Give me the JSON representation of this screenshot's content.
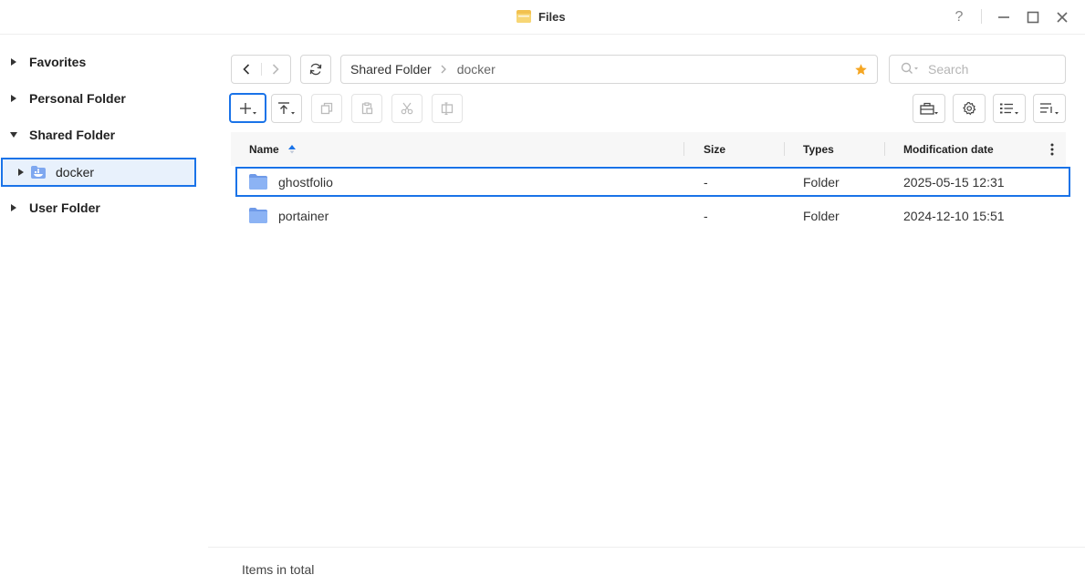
{
  "window": {
    "title": "Files",
    "controls": [
      "help-icon",
      "minimize-icon",
      "maximize-icon",
      "close-icon"
    ],
    "help_label": "?"
  },
  "sidebar": {
    "items": [
      {
        "label": "Favorites",
        "expanded": false
      },
      {
        "label": "Personal Folder",
        "expanded": false
      },
      {
        "label": "Shared Folder",
        "expanded": true,
        "children": [
          {
            "label": "docker",
            "icon": "shared-folder-icon",
            "selected": true
          }
        ]
      },
      {
        "label": "User Folder",
        "expanded": false
      }
    ]
  },
  "navigation": {
    "breadcrumb": [
      "Shared Folder",
      "docker"
    ],
    "favorite": true,
    "search": {
      "placeholder": "Search",
      "value": ""
    }
  },
  "toolbar": {
    "left_buttons": [
      {
        "icon": "plus-icon",
        "menu": true,
        "enabled": true
      },
      {
        "icon": "upload-icon",
        "menu": true,
        "enabled": true
      },
      {
        "icon": "copy-icon",
        "enabled": false
      },
      {
        "icon": "paste-icon",
        "enabled": false
      },
      {
        "icon": "cut-icon",
        "enabled": false
      },
      {
        "icon": "rename-icon",
        "enabled": false
      }
    ],
    "right_buttons": [
      {
        "icon": "toolbox-icon"
      },
      {
        "icon": "settings-icon"
      },
      {
        "icon": "view-list-icon",
        "menu": true
      },
      {
        "icon": "sort-icon",
        "menu": true
      }
    ]
  },
  "table": {
    "columns": [
      "Name",
      "Size",
      "Types",
      "Modification date"
    ],
    "sort": {
      "column": "Name",
      "direction": "asc"
    },
    "rows": [
      {
        "name": "ghostfolio",
        "size": "-",
        "type": "Folder",
        "modified": "2025-05-15 12:31",
        "selected": true
      },
      {
        "name": "portainer",
        "size": "-",
        "type": "Folder",
        "modified": "2024-12-10 15:51",
        "selected": false
      }
    ]
  },
  "status": {
    "text": "Items in total"
  },
  "colors": {
    "accent": "#1a73e8",
    "folder": "#7fa8f0",
    "star": "#f5a623",
    "selected_bg": "#e8f1fc"
  }
}
